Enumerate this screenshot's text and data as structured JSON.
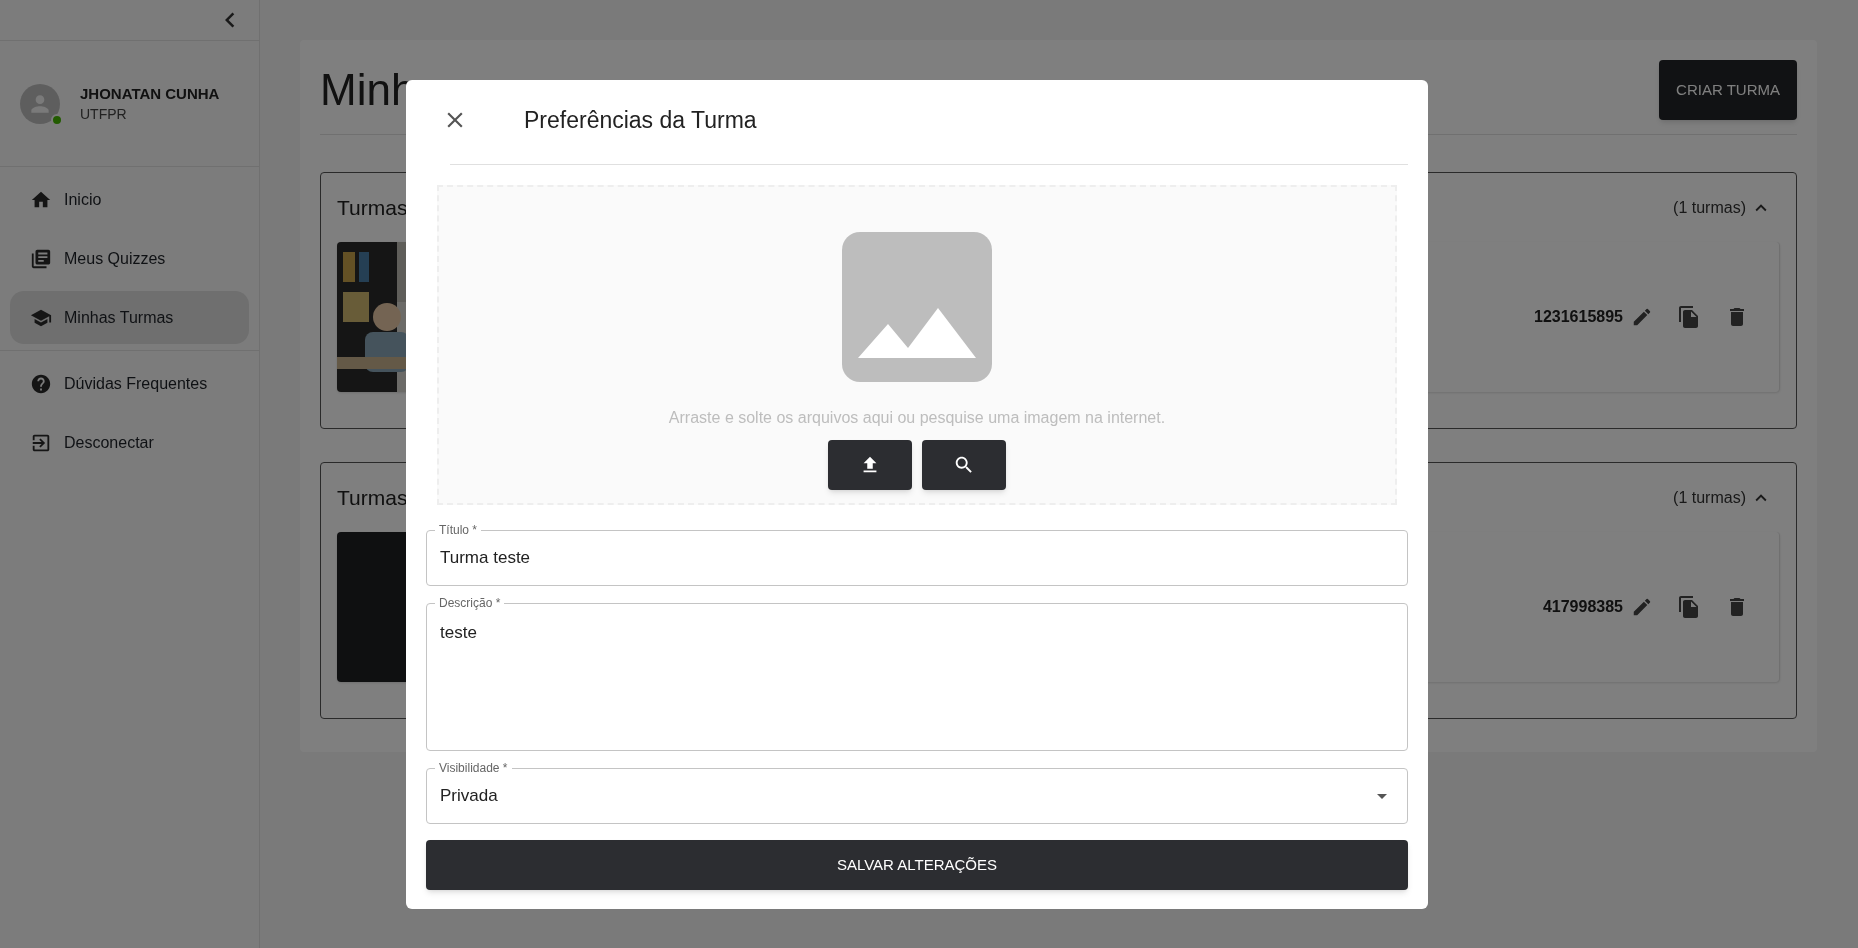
{
  "sidebar": {
    "user": {
      "name": "JHONATAN CUNHA",
      "org": "UTFPR",
      "online": true
    },
    "sections": [
      {
        "items": [
          {
            "label": "Inicio",
            "selected": false
          },
          {
            "label": "Meus Quizzes",
            "selected": false
          },
          {
            "label": "Minhas Turmas",
            "selected": true
          }
        ]
      },
      {
        "items": [
          {
            "label": "Dúvidas Frequentes",
            "selected": false
          },
          {
            "label": "Desconectar",
            "selected": false
          }
        ]
      }
    ]
  },
  "page": {
    "title": "Minh",
    "create_button": "CRIAR TURMA"
  },
  "groups": [
    {
      "heading": "Turmas",
      "count": "(1 turmas)",
      "expanded": true,
      "classes": [
        {
          "code": "1231615895",
          "kind": "picture"
        }
      ]
    },
    {
      "heading": "Turmas",
      "count": "(1 turmas)",
      "expanded": true,
      "classes": [
        {
          "code": "417998385",
          "kind": "placeholder"
        }
      ]
    }
  ],
  "modal": {
    "title": "Preferências da Turma",
    "dropzone": {
      "hint": "Arraste e solte os arquivos aqui ou pesquise uma imagem na internet."
    },
    "fields": [
      {
        "kind": "text",
        "label": "Título *",
        "value": "Turma teste"
      },
      {
        "kind": "textarea",
        "label": "Descrição *",
        "value": "teste"
      },
      {
        "kind": "select",
        "label": "Visibilidade *",
        "value": "Privada"
      }
    ],
    "submit": "SALVAR ALTERAÇÕES"
  }
}
